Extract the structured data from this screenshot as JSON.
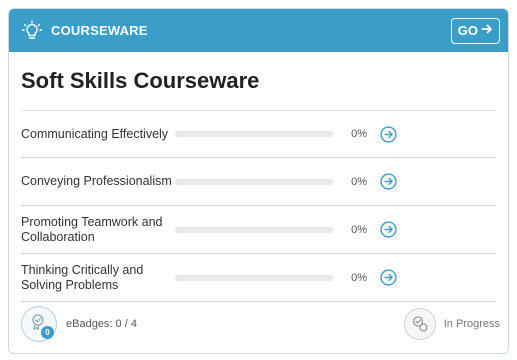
{
  "header": {
    "section_label": "COURSEWARE",
    "go_label": "GO",
    "bg_color": "#3a9ec8",
    "icon": "lightbulb-icon"
  },
  "course": {
    "title": "Soft Skills Courseware"
  },
  "modules": [
    {
      "label": "Communicating Effectively",
      "progress": 0,
      "percent_text": "0%"
    },
    {
      "label": "Conveying Professionalism",
      "progress": 0,
      "percent_text": "0%"
    },
    {
      "label": "Promoting Teamwork and Collaboration",
      "progress": 0,
      "percent_text": "0%"
    },
    {
      "label": "Thinking Critically and Solving Problems",
      "progress": 0,
      "percent_text": "0%"
    }
  ],
  "footer": {
    "ebadges_text": "eBadges: 0 / 4",
    "badge_count": "0",
    "status_text": "In Progress"
  },
  "colors": {
    "accent": "#3a9ec8",
    "title_text": "#222222"
  }
}
